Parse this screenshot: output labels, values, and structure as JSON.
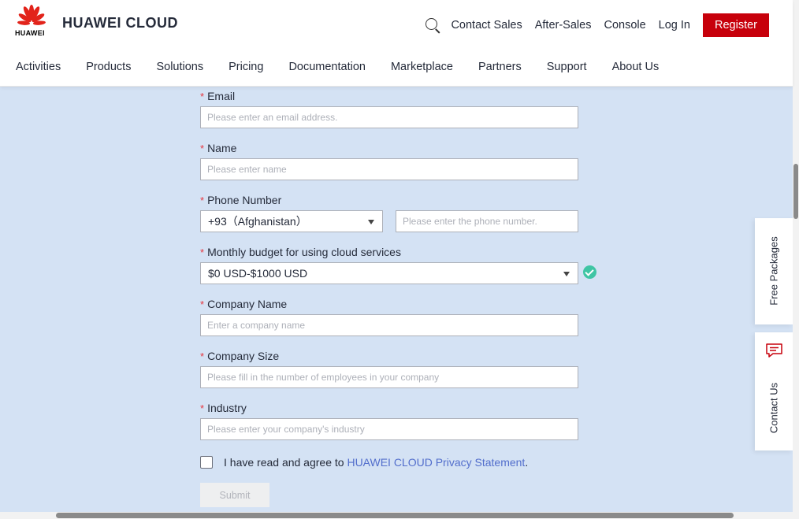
{
  "header": {
    "brand_wordmark": "HUAWEI",
    "brand": "HUAWEI CLOUD",
    "top_links": [
      "Contact Sales",
      "After-Sales",
      "Console",
      "Log In"
    ],
    "register_label": "Register",
    "nav": [
      "Activities",
      "Products",
      "Solutions",
      "Pricing",
      "Documentation",
      "Marketplace",
      "Partners",
      "Support",
      "About Us"
    ],
    "accent_color": "#c7000b"
  },
  "form": {
    "email": {
      "label": "Email",
      "placeholder": "Please enter an email address."
    },
    "name": {
      "label": "Name",
      "placeholder": "Please enter name"
    },
    "phone": {
      "label": "Phone Number",
      "country_code": "+93（Afghanistan）",
      "placeholder": "Please enter the phone number."
    },
    "budget": {
      "label": "Monthly budget for using cloud services",
      "value": "$0 USD-$1000 USD"
    },
    "company_name": {
      "label": "Company Name",
      "placeholder": "Enter a company name"
    },
    "company_size": {
      "label": "Company Size",
      "placeholder": "Please fill in the number of employees in your company"
    },
    "industry": {
      "label": "Industry",
      "placeholder": "Please enter your company's industry"
    },
    "agree_text": "I have read and agree to ",
    "agree_link": "HUAWEI CLOUD Privacy Statement",
    "agree_end": ".",
    "submit_label": "Submit"
  },
  "side": {
    "free_packages": "Free Packages",
    "contact_us": "Contact Us"
  }
}
